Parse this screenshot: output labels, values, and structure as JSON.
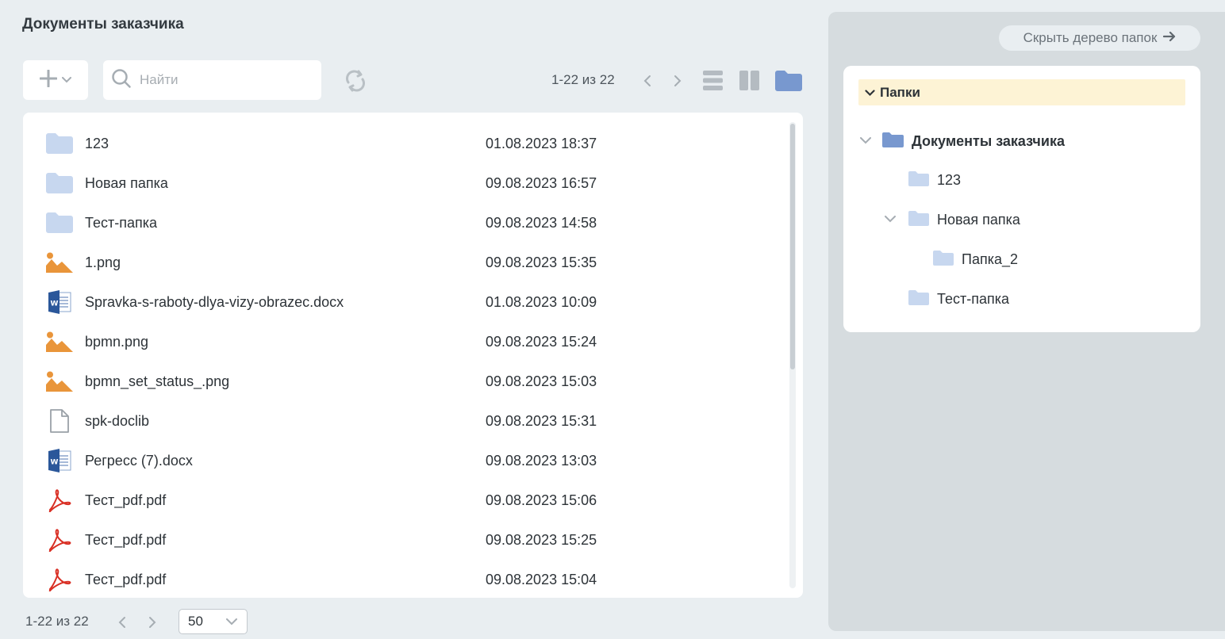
{
  "page": {
    "title": "Документы заказчика"
  },
  "toolbar": {
    "search_placeholder": "Найти",
    "pager_text": "1-22 из 22"
  },
  "files": [
    {
      "name": "123",
      "date": "01.08.2023 18:37",
      "type": "folder"
    },
    {
      "name": "Новая папка",
      "date": "09.08.2023 16:57",
      "type": "folder"
    },
    {
      "name": "Тест-папка",
      "date": "09.08.2023 14:58",
      "type": "folder"
    },
    {
      "name": "1.png",
      "date": "09.08.2023 15:35",
      "type": "image"
    },
    {
      "name": "Spravka-s-raboty-dlya-vizy-obrazec.docx",
      "date": "01.08.2023 10:09",
      "type": "word"
    },
    {
      "name": "bpmn.png",
      "date": "09.08.2023 15:24",
      "type": "image"
    },
    {
      "name": "bpmn_set_status_.png",
      "date": "09.08.2023 15:03",
      "type": "image"
    },
    {
      "name": "spk-doclib",
      "date": "09.08.2023 15:31",
      "type": "file"
    },
    {
      "name": "Регресс (7).docx",
      "date": "09.08.2023 13:03",
      "type": "word"
    },
    {
      "name": "Тест_pdf.pdf",
      "date": "09.08.2023 15:06",
      "type": "pdf"
    },
    {
      "name": "Тест_pdf.pdf",
      "date": "09.08.2023 15:25",
      "type": "pdf"
    },
    {
      "name": "Тест_pdf.pdf",
      "date": "09.08.2023 15:04",
      "type": "pdf"
    }
  ],
  "footer": {
    "pager_text": "1-22 из 22",
    "per_page": "50"
  },
  "tree": {
    "hide_label": "Скрыть дерево папок",
    "header": "Папки",
    "nodes": [
      {
        "label": "Документы заказчика",
        "expanded": true
      },
      {
        "label": "123"
      },
      {
        "label": "Новая папка",
        "expanded": true
      },
      {
        "label": "Папка_2"
      },
      {
        "label": "Тест-папка"
      }
    ]
  },
  "colors": {
    "folder_light": "#c7d7ef",
    "folder_accent": "#7898cf",
    "image_orange": "#e9953a",
    "word_blue": "#2b579a",
    "pdf_red": "#d93025",
    "tree_header_bg": "#fdf3d5"
  }
}
